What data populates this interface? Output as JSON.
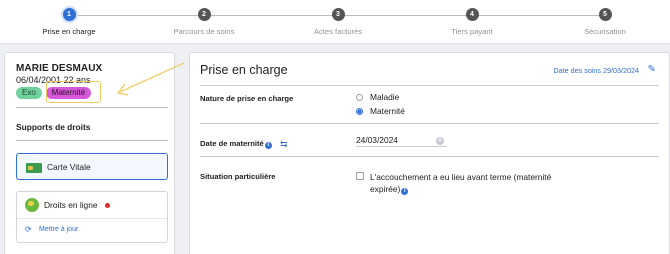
{
  "stepper": {
    "steps": [
      {
        "num": "1",
        "label": "Prise en charge"
      },
      {
        "num": "2",
        "label": "Parcours de soins"
      },
      {
        "num": "3",
        "label": "Actes facturés"
      },
      {
        "num": "4",
        "label": "Tiers payant"
      },
      {
        "num": "5",
        "label": "Sécurisation"
      }
    ],
    "active_step": 1
  },
  "patient": {
    "name": "MARIE DESMAUX",
    "dob_age": "06/04/2001 22 ans",
    "badges": {
      "exo": "Exo",
      "maternite": "Maternité"
    }
  },
  "rights": {
    "title": "Supports de droits",
    "carte_vitale": "Carte Vitale",
    "droits_en_ligne": "Droits en ligne",
    "update_link": "Mettre à jour"
  },
  "panel": {
    "title": "Prise en charge",
    "care_date": "Date des soins 29/03/2024",
    "nature_label": "Nature de prise en charge",
    "options": {
      "maladie": "Maladie",
      "maternite": "Maternité"
    },
    "selected_option": "Maternité",
    "maternity_date_label": "Date de maternité",
    "maternity_date_value": "24/03/2024",
    "situation_label": "Situation particulière",
    "premature_label": "L'accouchement a eu lieu avant terme (maternité expirée)"
  },
  "icons": {
    "pencil": "pencil-icon",
    "info": "info-icon",
    "link": "link-icon",
    "clear": "clear-icon",
    "refresh": "refresh-icon",
    "carte": "carte-vitale-icon",
    "globe": "globe-icon"
  },
  "colors": {
    "accent": "#2f6fd6",
    "exo_badge": "#6fd19b",
    "maternite_badge": "#d65ad7",
    "highlight": "#f1c85a",
    "alert_dot": "#e02a2a"
  }
}
